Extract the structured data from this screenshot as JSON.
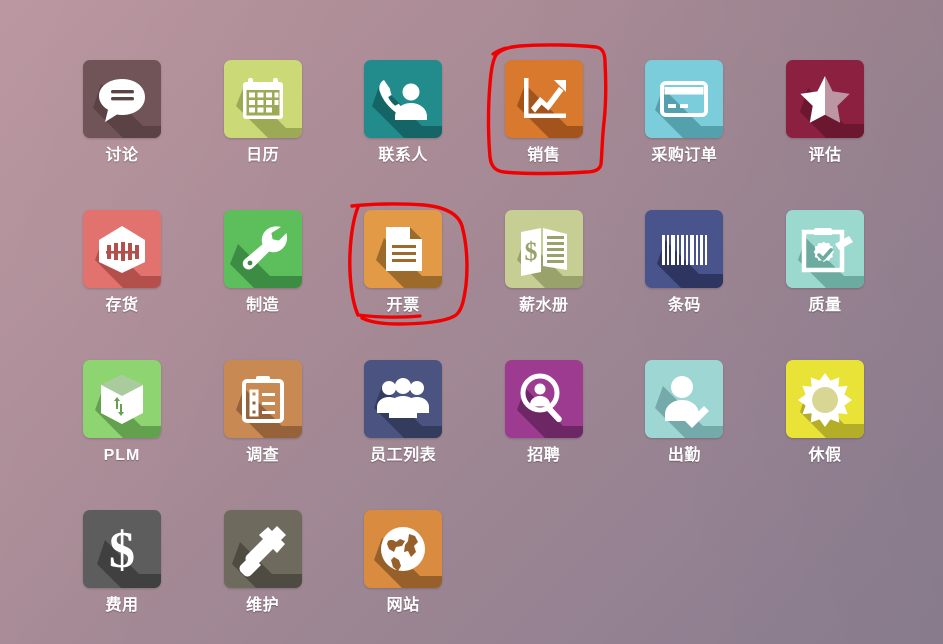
{
  "screen": {
    "name": "odoo-apps-home-grid",
    "background_gradient_from": "#b8939d",
    "background_gradient_to": "#8a7d8e",
    "columns": 6
  },
  "apps": [
    {
      "label": "讨论",
      "icon": "chat-bubble-icon",
      "bg": "#705457",
      "shadow": "#5a4245",
      "fg": "#ffffff",
      "row": 0,
      "col": 0
    },
    {
      "label": "日历",
      "icon": "calendar-icon",
      "bg": "#ccd977",
      "shadow": "#9caa56",
      "fg": "#ffffff",
      "row": 0,
      "col": 1
    },
    {
      "label": "联系人",
      "icon": "contact-phone-icon",
      "bg": "#228c8c",
      "shadow": "#156566",
      "fg": "#ffffff",
      "row": 0,
      "col": 2
    },
    {
      "label": "销售",
      "icon": "sales-chart-icon",
      "bg": "#d9792e",
      "shadow": "#a2541c",
      "fg": "#ffffff",
      "row": 0,
      "col": 3
    },
    {
      "label": "采购订单",
      "icon": "credit-card-icon",
      "bg": "#7ccddb",
      "shadow": "#55a0ad",
      "fg": "#ffffff",
      "row": 0,
      "col": 4
    },
    {
      "label": "评估",
      "icon": "star-half-icon",
      "bg": "#8c2040",
      "shadow": "#6b1730",
      "fg": "#ffffff",
      "row": 0,
      "col": 5
    },
    {
      "label": "存货",
      "icon": "warehouse-icon",
      "bg": "#e2726d",
      "shadow": "#b4504c",
      "fg": "#ffffff",
      "row": 1,
      "col": 0
    },
    {
      "label": "制造",
      "icon": "wrench-icon",
      "bg": "#5cbf5c",
      "shadow": "#3d8c43",
      "fg": "#ffffff",
      "row": 1,
      "col": 1
    },
    {
      "label": "开票",
      "icon": "invoice-document-icon",
      "bg": "#e39a46",
      "shadow": "#9c6a2b",
      "fg": "#ffffff",
      "row": 1,
      "col": 2
    },
    {
      "label": "薪水册",
      "icon": "payroll-money-icon",
      "bg": "#c6ce93",
      "shadow": "#9aa26b",
      "fg": "#ffffff",
      "row": 1,
      "col": 3
    },
    {
      "label": "条码",
      "icon": "barcode-icon",
      "bg": "#49548c",
      "shadow": "#2e3560",
      "fg": "#ffffff",
      "row": 1,
      "col": 4
    },
    {
      "label": "质量",
      "icon": "quality-clipboard-icon",
      "bg": "#9bd9cf",
      "shadow": "#6cab9f",
      "fg": "#ffffff",
      "row": 1,
      "col": 5
    },
    {
      "label": "PLM",
      "icon": "plm-box-icon",
      "bg": "#8ed470",
      "shadow": "#63a14f",
      "fg": "#ffffff",
      "row": 2,
      "col": 0
    },
    {
      "label": "调查",
      "icon": "survey-clipboard-icon",
      "bg": "#c88a52",
      "shadow": "#96623a",
      "fg": "#ffffff",
      "row": 2,
      "col": 1
    },
    {
      "label": "员工列表",
      "icon": "employees-group-icon",
      "bg": "#4b5480",
      "shadow": "#343c5e",
      "fg": "#ffffff",
      "row": 2,
      "col": 2
    },
    {
      "label": "招聘",
      "icon": "recruit-search-icon",
      "bg": "#9c3b8f",
      "shadow": "#6e2765",
      "fg": "#ffffff",
      "row": 2,
      "col": 3
    },
    {
      "label": "出勤",
      "icon": "attendance-check-icon",
      "bg": "#9ed6d4",
      "shadow": "#74aaa9",
      "fg": "#ffffff",
      "row": 2,
      "col": 4
    },
    {
      "label": "休假",
      "icon": "sun-leave-icon",
      "bg": "#e8e336",
      "shadow": "#b3ad28",
      "fg": "#ffffff",
      "row": 2,
      "col": 5
    },
    {
      "label": "费用",
      "icon": "dollar-expense-icon",
      "bg": "#5d5d5d",
      "shadow": "#404040",
      "fg": "#ffffff",
      "row": 3,
      "col": 0
    },
    {
      "label": "维护",
      "icon": "hammer-icon",
      "bg": "#6e6a5e",
      "shadow": "#4e4b42",
      "fg": "#ffffff",
      "row": 3,
      "col": 1
    },
    {
      "label": "网站",
      "icon": "globe-website-icon",
      "bg": "#d98b3f",
      "shadow": "#97602a",
      "fg": "#ffffff",
      "row": 3,
      "col": 2
    }
  ],
  "annotations": [
    {
      "name": "sales-circle-annotation",
      "shape": "closed-rect-scribble",
      "color": "#f00000",
      "targets_label": "销售"
    },
    {
      "name": "invoicing-circle-annotation",
      "shape": "open-c-scribble",
      "color": "#f00000",
      "targets_label": "开票"
    }
  ]
}
